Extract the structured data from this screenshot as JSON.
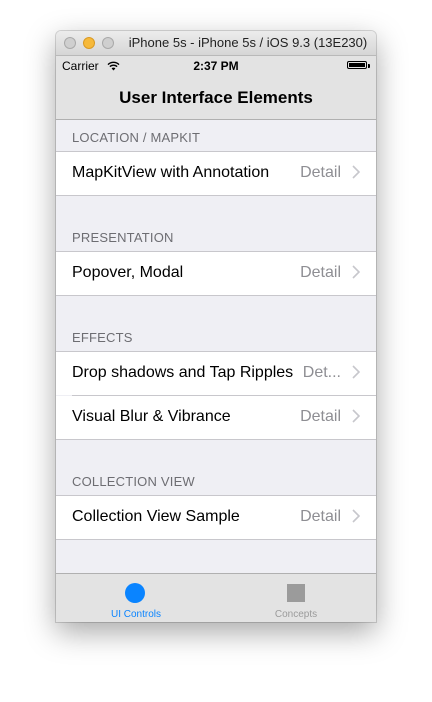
{
  "window": {
    "title": "iPhone 5s - iPhone 5s / iOS 9.3 (13E230)"
  },
  "status_bar": {
    "carrier": "Carrier",
    "time": "2:37 PM",
    "wifi_icon": "wifi-icon",
    "battery_icon": "battery-icon"
  },
  "nav": {
    "title": "User Interface Elements"
  },
  "sections": [
    {
      "header": "LOCATION / MAPKIT",
      "rows": [
        {
          "label": "MapKitView with Annotation",
          "detail": "Detail"
        }
      ]
    },
    {
      "header": "PRESENTATION",
      "rows": [
        {
          "label": "Popover, Modal",
          "detail": "Detail"
        }
      ]
    },
    {
      "header": "EFFECTS",
      "rows": [
        {
          "label": "Drop shadows and Tap Ripples",
          "detail": "Det..."
        },
        {
          "label": "Visual Blur & Vibrance",
          "detail": "Detail"
        }
      ]
    },
    {
      "header": "COLLECTION VIEW",
      "rows": [
        {
          "label": "Collection View Sample",
          "detail": "Detail"
        }
      ]
    }
  ],
  "tabs": [
    {
      "label": "UI Controls",
      "selected": true,
      "icon": "circle-icon",
      "color": "#0a84ff"
    },
    {
      "label": "Concepts",
      "selected": false,
      "icon": "square-icon",
      "color": "#9b9b9b"
    }
  ],
  "colors": {
    "accent": "#0a84ff",
    "detail": "#8e8e93",
    "section_header": "#6d6d72",
    "grouped_background": "#efeff4"
  }
}
